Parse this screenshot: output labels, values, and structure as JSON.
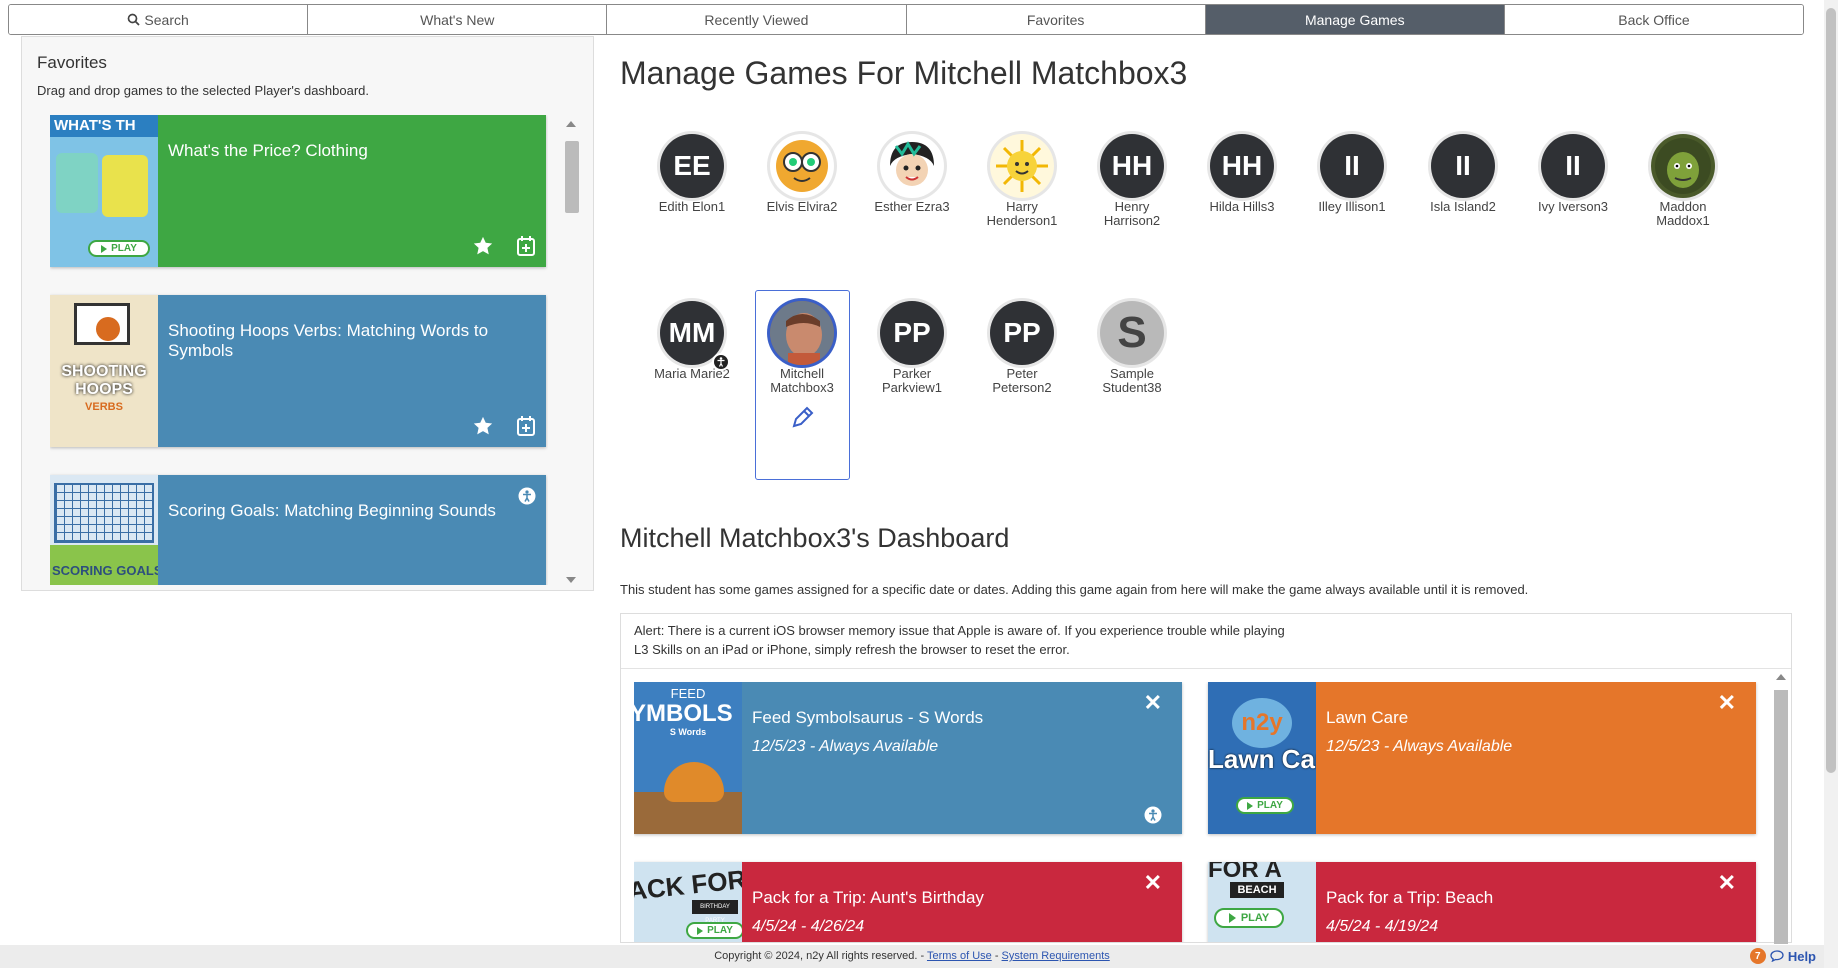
{
  "nav": {
    "tabs": [
      {
        "label": "Search",
        "icon": "search-icon"
      },
      {
        "label": "What's New"
      },
      {
        "label": "Recently Viewed"
      },
      {
        "label": "Favorites"
      },
      {
        "label": "Manage Games",
        "active": true
      },
      {
        "label": "Back Office"
      }
    ]
  },
  "favorites": {
    "title": "Favorites",
    "subtitle": "Drag and drop games to the selected Player's dashboard.",
    "games": [
      {
        "title": "What's the Price? Clothing",
        "color": "#3ea743",
        "thumb_text": "WHAT'S TH",
        "play": "PLAY"
      },
      {
        "title": "Shooting Hoops Verbs: Matching Words to Symbols",
        "color": "#4a8ab4",
        "thumb_text": "SHOOTING HOOPS",
        "thumb_sub": "VERBS"
      },
      {
        "title": "Scoring Goals: Matching Beginning Sounds",
        "color": "#4a8ab4",
        "thumb_text": "SCORING GOALS"
      }
    ]
  },
  "main": {
    "title": "Manage Games For Mitchell Matchbox3",
    "players_row1": [
      {
        "initials": "EE",
        "name": "Edith Elon1"
      },
      {
        "initials": "",
        "name": "Elvis Elvira2",
        "avatar": "owl"
      },
      {
        "initials": "",
        "name": "Esther Ezra3",
        "avatar": "girl"
      },
      {
        "initials": "",
        "name": "Harry Henderson1",
        "avatar": "sun"
      },
      {
        "initials": "HH",
        "name": "Henry Harrison2"
      },
      {
        "initials": "HH",
        "name": "Hilda Hills3"
      },
      {
        "initials": "II",
        "name": "Illey Illison1"
      },
      {
        "initials": "II",
        "name": "Isla Island2"
      },
      {
        "initials": "II",
        "name": "Ivy Iverson3"
      },
      {
        "initials": "",
        "name": "Maddon Maddox1",
        "avatar": "goblin"
      }
    ],
    "players_row2": [
      {
        "initials": "MM",
        "name": "Maria Marie2",
        "accessibility": true
      },
      {
        "initials": "",
        "name": "Mitchell Matchbox3",
        "avatar": "photo",
        "selected": true
      },
      {
        "initials": "PP",
        "name": "Parker Parkview1"
      },
      {
        "initials": "PP",
        "name": "Peter Peterson2"
      },
      {
        "initials": "S",
        "name": "Sample Student38",
        "avatar": "gray"
      }
    ]
  },
  "dashboard": {
    "title": "Mitchell Matchbox3's Dashboard",
    "note": "This student has some games assigned for a specific date or dates. Adding this game again from here will make the game always available until it is removed.",
    "alert_line1": "Alert: There is a current iOS browser memory issue that Apple is aware of. If you experience trouble while playing",
    "alert_line2": "L3 Skills on an iPad or iPhone, simply refresh the browser to reset the error.",
    "games": [
      {
        "title": "Feed Symbolsaurus - S Words",
        "date": "12/5/23 - Always Available",
        "color": "#4a8ab4",
        "thumb_text": "FEED",
        "thumb_big": "YMBOLS",
        "thumb_sub": "S Words"
      },
      {
        "title": "Lawn Care",
        "date": "12/5/23 - Always Available",
        "color": "#e5762a",
        "thumb_text": "n2y",
        "thumb_big": "Lawn Car",
        "play": "PLAY"
      },
      {
        "title": "Pack for a Trip: Aunt's Birthday",
        "date": "4/5/24 - 4/26/24",
        "color": "#c9283e",
        "thumb_big": "ACK FOR",
        "thumb_sub": "BIRTHDAY PARTY",
        "play": "PLAY"
      },
      {
        "title": "Pack for a Trip: Beach",
        "date": "4/5/24 - 4/19/24",
        "color": "#c9283e",
        "thumb_big": "FOR A",
        "thumb_sub": "BEACH",
        "play": "PLAY"
      }
    ]
  },
  "footer": {
    "copyright": "Copyright © 2024, n2y All rights reserved. - ",
    "terms": "Terms of Use",
    "sep": " - ",
    "requirements": "System Requirements",
    "help_count": "7",
    "help_label": "Help"
  }
}
